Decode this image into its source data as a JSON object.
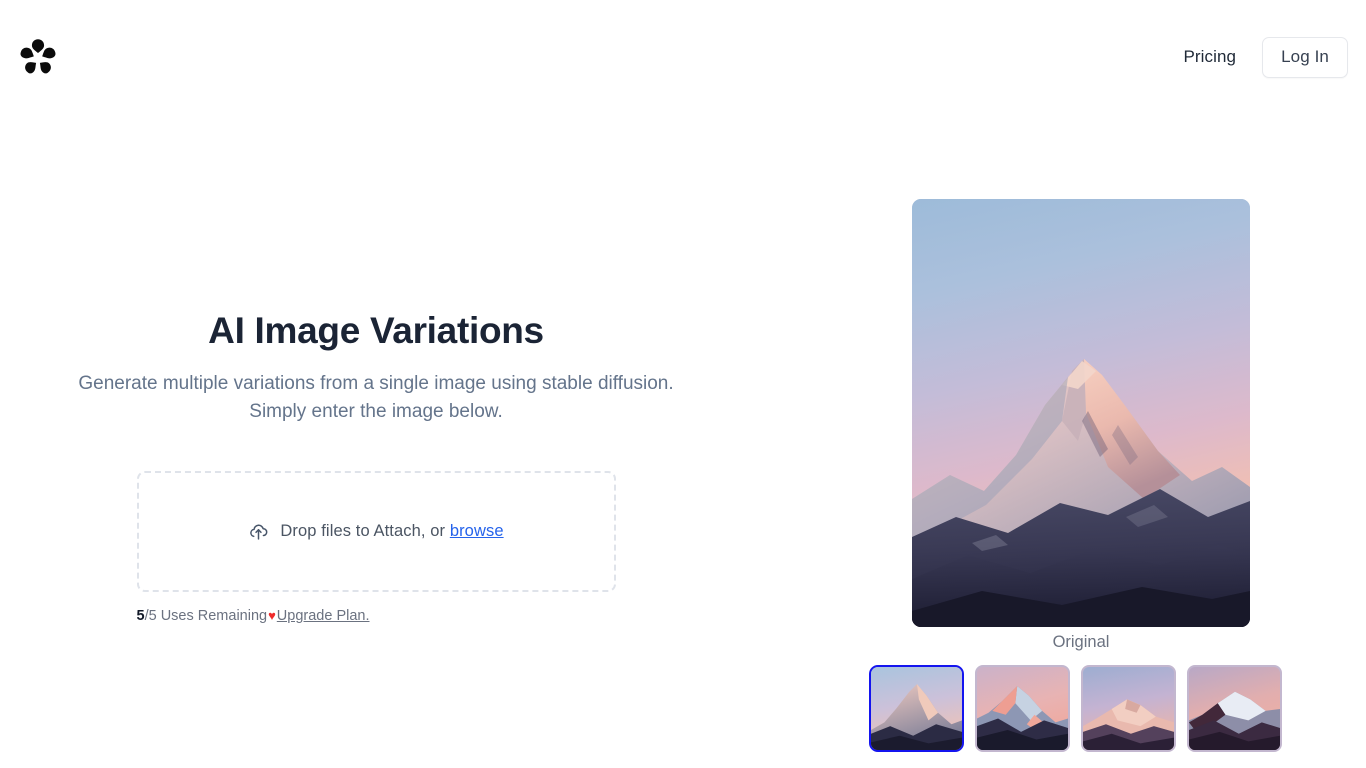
{
  "header": {
    "logo_name": "sakura-flower-logo",
    "pricing_label": "Pricing",
    "login_label": "Log In"
  },
  "hero": {
    "title": "AI Image Variations",
    "subtitle": "Generate multiple variations from a single image using stable diffusion. Simply enter the image below."
  },
  "dropzone": {
    "icon": "cloud-upload-icon",
    "text": "Drop files to Attach, or",
    "browse_label": "browse"
  },
  "usage": {
    "count": "5",
    "total": "/5 Uses Remaining",
    "heart": "♥",
    "upgrade_label": "Upgrade Plan."
  },
  "preview": {
    "caption": "Original",
    "thumbnails": [
      {
        "name": "thumbnail-original",
        "selected": true
      },
      {
        "name": "thumbnail-variation-1",
        "selected": false
      },
      {
        "name": "thumbnail-variation-2",
        "selected": false
      },
      {
        "name": "thumbnail-variation-3",
        "selected": false
      }
    ]
  },
  "colors": {
    "accent_link": "#2563eb",
    "selected_border": "#1414ef",
    "heading": "#1b2435",
    "muted_text": "#64748b",
    "heart_red": "#ef2b2b"
  }
}
